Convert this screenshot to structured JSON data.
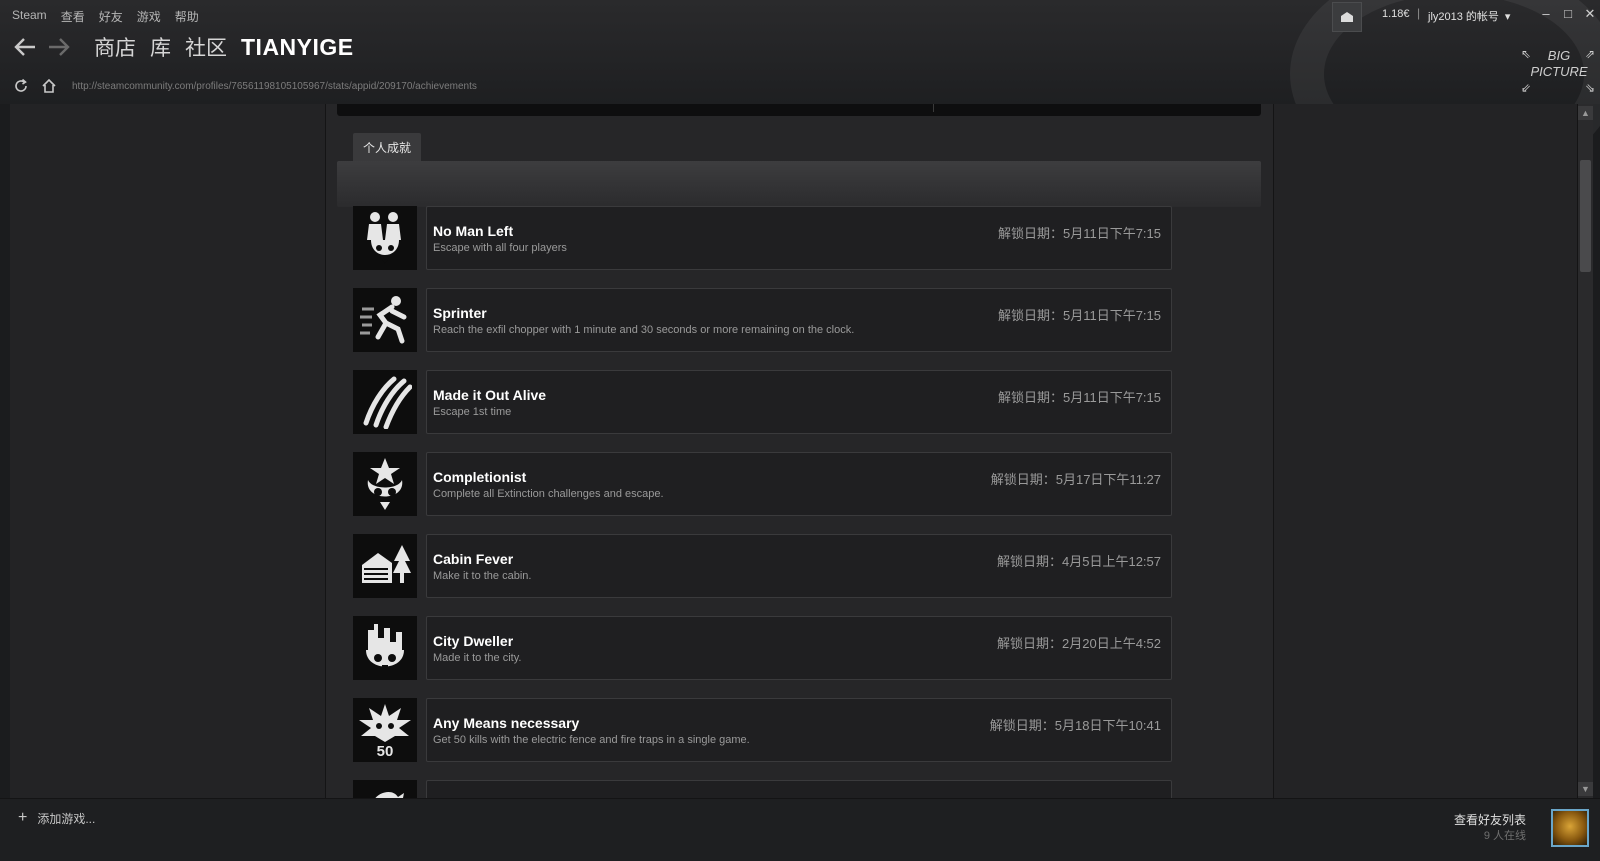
{
  "menu": [
    "Steam",
    "查看",
    "好友",
    "游戏",
    "帮助"
  ],
  "nav": {
    "tabs": [
      "商店",
      "库",
      "社区",
      "TIANYIGE"
    ],
    "url": "http://steamcommunity.com/profiles/76561198105105967/stats/appid/209170/achievements"
  },
  "account": {
    "wallet": "1.18€",
    "name": "jly2013 的帐号"
  },
  "big_picture": {
    "line1": "BIG",
    "line2": "PICTURE"
  },
  "section": {
    "tab_label": "个人成就"
  },
  "achievements": [
    {
      "title": "No Man Left",
      "desc": "Escape with all four players",
      "date": "解锁日期：5月11日下午7:15",
      "icon": "two-soldiers-skull-icon"
    },
    {
      "title": "Sprinter",
      "desc": "Reach the exfil chopper with 1 minute and 30 seconds or more remaining on the clock.",
      "date": "解锁日期：5月11日下午7:15",
      "icon": "running-man-icon"
    },
    {
      "title": "Made it Out Alive",
      "desc": "Escape 1st time",
      "date": "解锁日期：5月11日下午7:15",
      "icon": "claw-marks-icon"
    },
    {
      "title": "Completionist",
      "desc": "Complete all Extinction challenges and escape.",
      "date": "解锁日期：5月17日下午11:27",
      "icon": "skull-star-icon"
    },
    {
      "title": "Cabin Fever",
      "desc": "Make it to the cabin.",
      "date": "解锁日期：4月5日上午12:57",
      "icon": "cabin-tree-icon"
    },
    {
      "title": "City Dweller",
      "desc": "Made it to the city.",
      "date": "解锁日期：2月20日上午4:52",
      "icon": "city-skull-icon"
    },
    {
      "title": "Any Means necessary",
      "desc": "Get 50 kills with the electric fence and fire traps in a single game.",
      "date": "解锁日期：5月18日下午10:41",
      "icon": "spiky-skull-50-icon"
    }
  ],
  "bottom": {
    "add_game": "添加游戏...",
    "friends_title": "查看好友列表",
    "friends_online": "9 人在线"
  }
}
